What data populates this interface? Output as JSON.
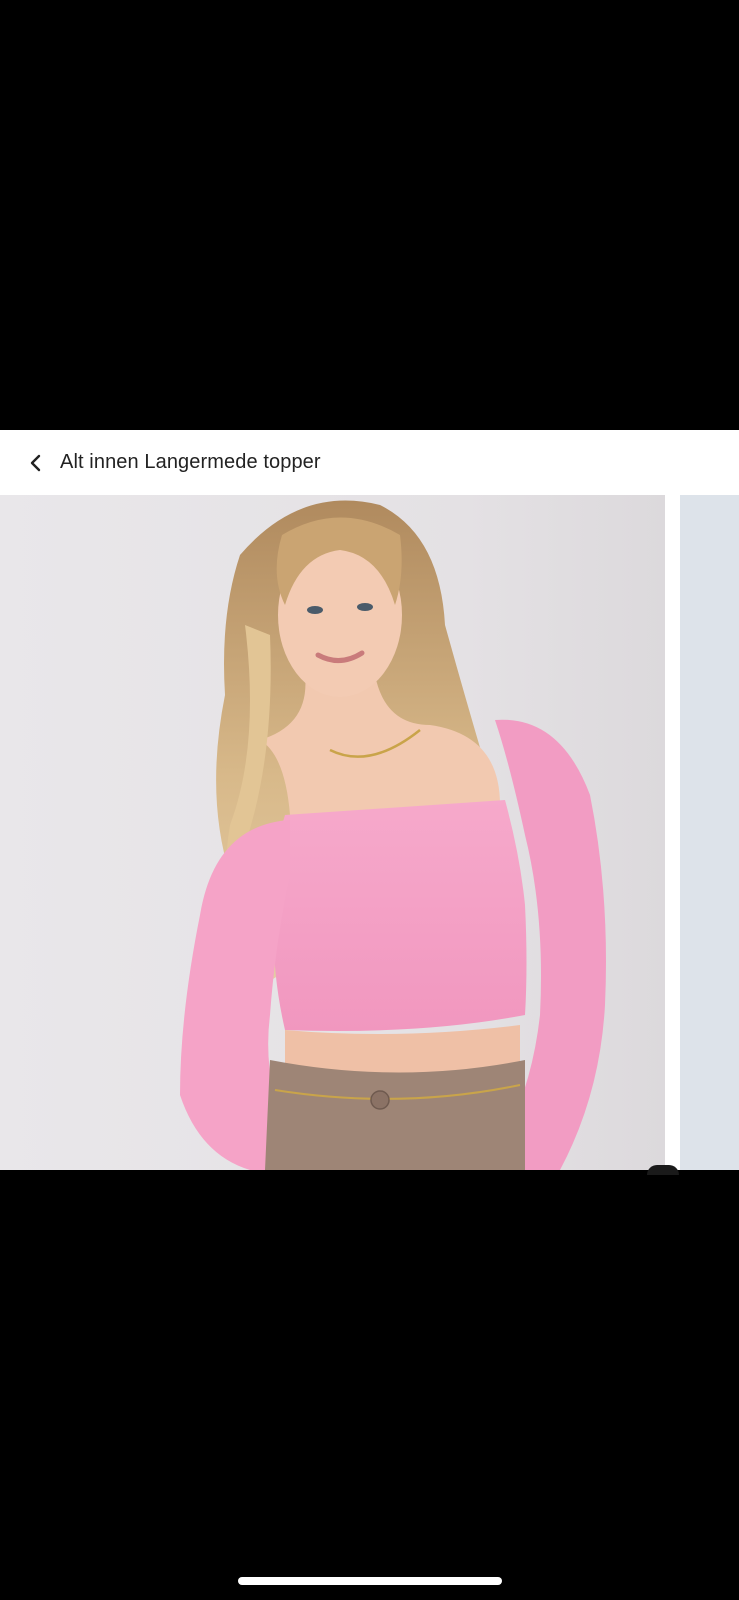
{
  "header": {
    "back_icon": "chevron-left-icon",
    "title": "Alt innen Langermede topper"
  },
  "gallery": {
    "current_image": "product-photo-pink-top",
    "next_image": "product-photo-next"
  },
  "colors": {
    "header_bg": "#ffffff",
    "title_text": "#222222",
    "photo_bg": "#e6e3e5",
    "top_pink": "#f5a3c7",
    "pants": "#9e8576"
  }
}
